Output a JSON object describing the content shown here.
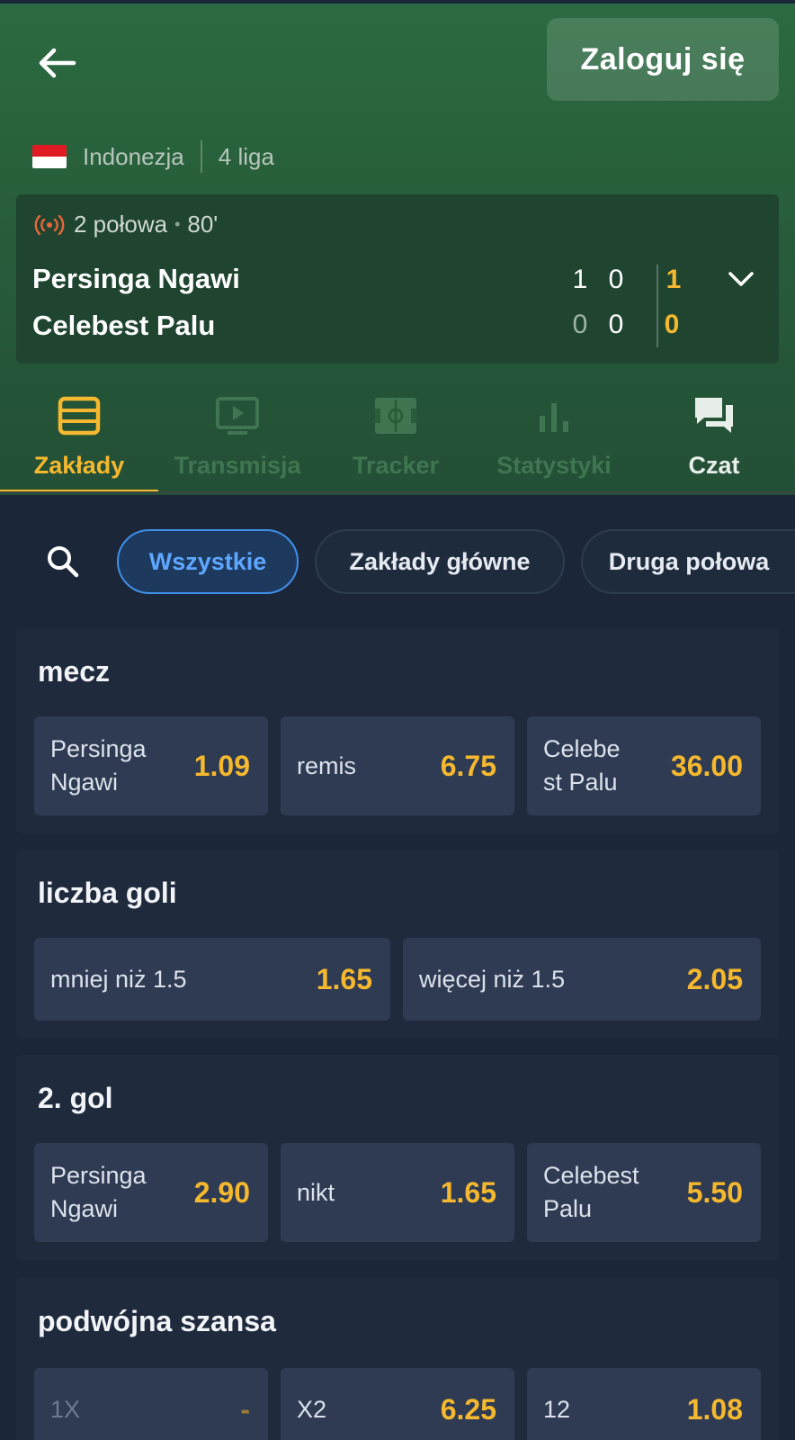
{
  "header": {
    "login_label": "Zaloguj się",
    "country": "Indonezja",
    "league": "4 liga"
  },
  "match": {
    "period": "2 połowa",
    "minute": "80'",
    "home": {
      "name": "Persinga Ngawi",
      "h1": "1",
      "h2": "0",
      "total": "1"
    },
    "away": {
      "name": "Celebest Palu",
      "h1": "0",
      "h2": "0",
      "total": "0"
    }
  },
  "tabs": [
    {
      "label": "Zakłady",
      "icon": "list-icon",
      "state": "active"
    },
    {
      "label": "Transmisja",
      "icon": "play-screen-icon",
      "state": "disabled"
    },
    {
      "label": "Tracker",
      "icon": "pitch-icon",
      "state": "disabled"
    },
    {
      "label": "Statystyki",
      "icon": "bar-chart-icon",
      "state": "disabled"
    },
    {
      "label": "Czat",
      "icon": "chat-icon",
      "state": "normal"
    }
  ],
  "filters": [
    "Wszystkie",
    "Zakłady główne",
    "Druga połowa"
  ],
  "markets": [
    {
      "title": "mecz",
      "odds": [
        {
          "label": "Persinga\nNgawi",
          "value": "1.09"
        },
        {
          "label": "remis",
          "value": "6.75"
        },
        {
          "label": "Celebe\nst Palu",
          "value": "36.00"
        }
      ]
    },
    {
      "title": "liczba goli",
      "odds": [
        {
          "label": "mniej niż 1.5",
          "value": "1.65"
        },
        {
          "label": "więcej niż 1.5",
          "value": "2.05"
        }
      ]
    },
    {
      "title": "2. gol",
      "odds": [
        {
          "label": "Persinga\nNgawi",
          "value": "2.90"
        },
        {
          "label": "nikt",
          "value": "1.65"
        },
        {
          "label": "Celebest\nPalu",
          "value": "5.50"
        }
      ]
    },
    {
      "title": "podwójna szansa",
      "odds": [
        {
          "label": "1X",
          "value": "-"
        },
        {
          "label": "X2",
          "value": "6.25"
        },
        {
          "label": "12",
          "value": "1.08"
        }
      ]
    }
  ],
  "colors": {
    "accent": "#f5b82e",
    "header_green": "#2b6a40",
    "background": "#1b2639",
    "chip_active": "#3f8ee8",
    "live": "#e8663a"
  }
}
